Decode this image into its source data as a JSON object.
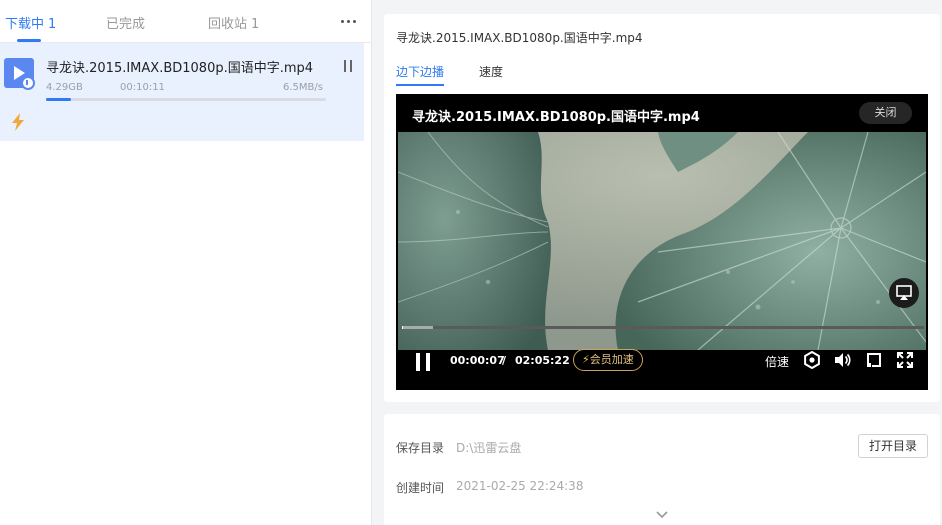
{
  "left": {
    "tabs": [
      {
        "label": "下载中",
        "count": "1"
      },
      {
        "label": "已完成",
        "count": ""
      },
      {
        "label": "回收站",
        "count": "1"
      }
    ],
    "download": {
      "file_name": "寻龙诀.2015.IMAX.BD1080p.国语中字.mp4",
      "size": "4.29GB",
      "remaining": "00:10:11",
      "speed": "6.5MB/s"
    }
  },
  "right": {
    "title": "寻龙诀.2015.IMAX.BD1080p.国语中字.mp4",
    "tabs": [
      "边下边播",
      "速度"
    ],
    "player": {
      "title": "寻龙诀.2015.IMAX.BD1080p.国语中字.mp4",
      "close_label": "关闭",
      "current_time": "00:00:07",
      "separator": "/",
      "total_time": "02:05:22",
      "vip_label": "会员加速",
      "speed_label": "倍速"
    },
    "info": {
      "save_dir_label": "保存目录",
      "save_dir": "D:\\迅雷云盘",
      "open_dir_label": "打开目录",
      "created_label": "创建时间",
      "created": "2021-02-25 22:24:38"
    }
  },
  "colors": {
    "accent": "#2f7bf5",
    "vip": "#e7c37d"
  }
}
